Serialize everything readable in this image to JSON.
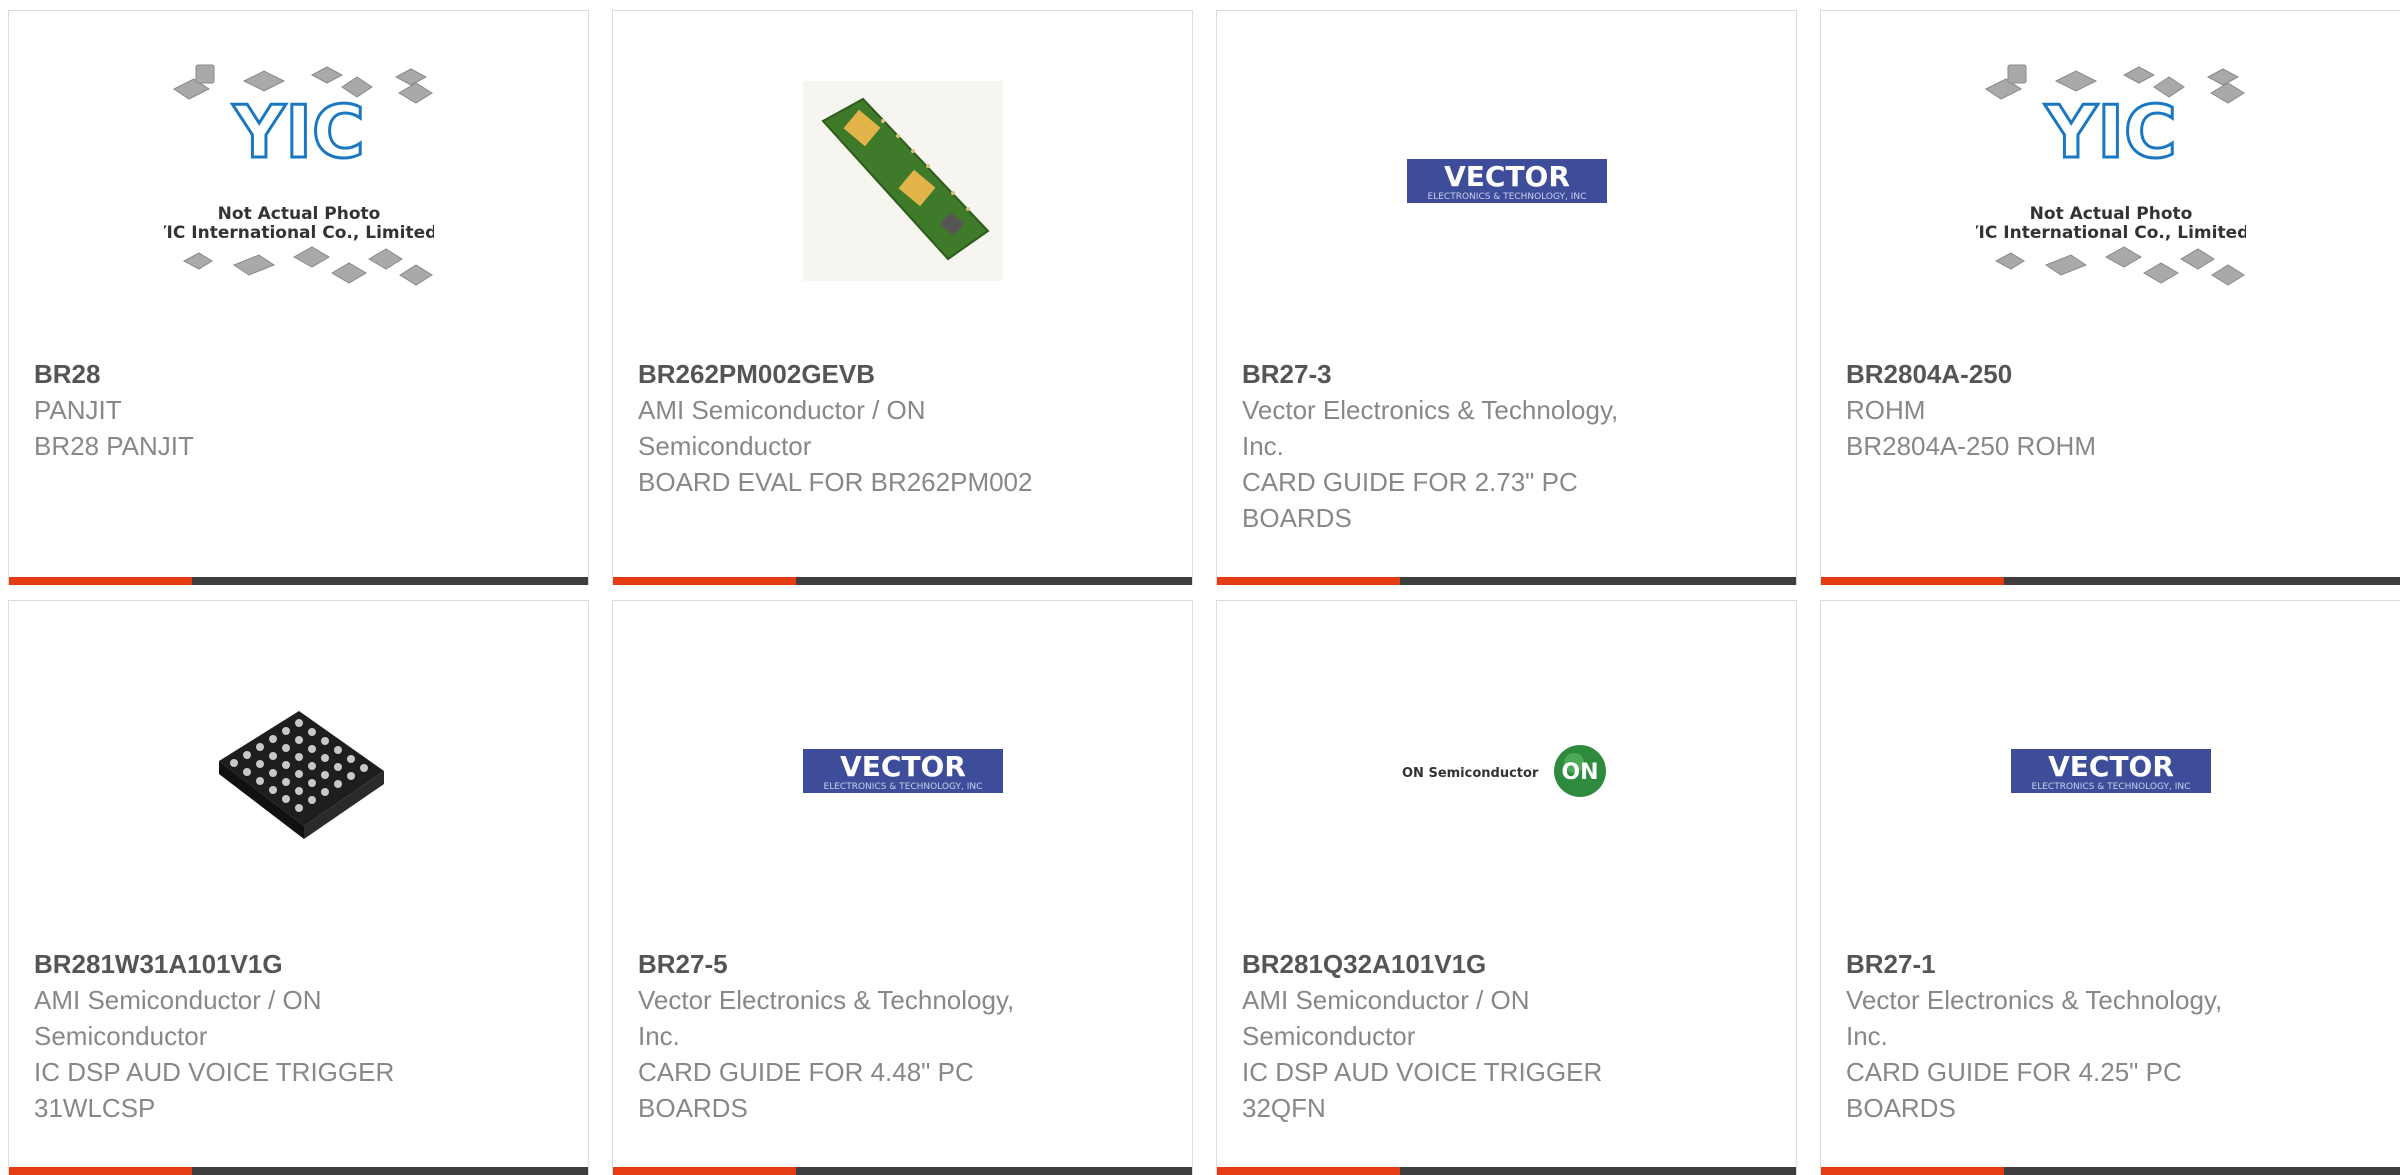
{
  "products": [
    {
      "part": "BR28",
      "manufacturer": "PANJIT",
      "description": "BR28 PANJIT",
      "image": "yic-placeholder-photo"
    },
    {
      "part": "BR262PM002GEVB",
      "manufacturer": "AMI Semiconductor / ON Semiconductor",
      "description": "BOARD EVAL FOR BR262PM002",
      "image": "eval-board-photo"
    },
    {
      "part": "BR27-3",
      "manufacturer": "Vector Electronics & Technology, Inc.",
      "description": "CARD GUIDE FOR 2.73\" PC BOARDS",
      "image": "vector-logo"
    },
    {
      "part": "BR2804A-250",
      "manufacturer": "ROHM",
      "description": "BR2804A-250 ROHM",
      "image": "yic-placeholder-photo"
    },
    {
      "part": "BR281W31A101V1G",
      "manufacturer": "AMI Semiconductor / ON Semiconductor",
      "description": "IC DSP AUD VOICE TRIGGER 31WLCSP",
      "image": "wlcsp-chip-photo"
    },
    {
      "part": "BR27-5",
      "manufacturer": "Vector Electronics & Technology, Inc.",
      "description": "CARD GUIDE FOR 4.48\" PC BOARDS",
      "image": "vector-logo"
    },
    {
      "part": "BR281Q32A101V1G",
      "manufacturer": "AMI Semiconductor / ON Semiconductor",
      "description": "IC DSP AUD VOICE TRIGGER 32QFN",
      "image": "on-semiconductor-logo"
    },
    {
      "part": "BR27-1",
      "manufacturer": "Vector Electronics & Technology, Inc.",
      "description": "CARD GUIDE FOR 4.25\" PC BOARDS",
      "image": "vector-logo"
    }
  ],
  "logos": {
    "yic": {
      "brand": "YIC",
      "line1": "Not Actual Photo",
      "line2": "YIC International Co., Limited."
    },
    "vector": {
      "brand": "VECTOR",
      "sub": "ELECTRONICS & TECHNOLOGY, INC"
    },
    "onsemi": {
      "brand": "ON Semiconductor",
      "mark": "ON"
    }
  },
  "colors": {
    "accent": "#e63c13",
    "bar": "#3e3e3e",
    "part": "#555555",
    "text": "#888888",
    "vector_blue": "#3d4d99",
    "on_green": "#2e8b3d"
  }
}
